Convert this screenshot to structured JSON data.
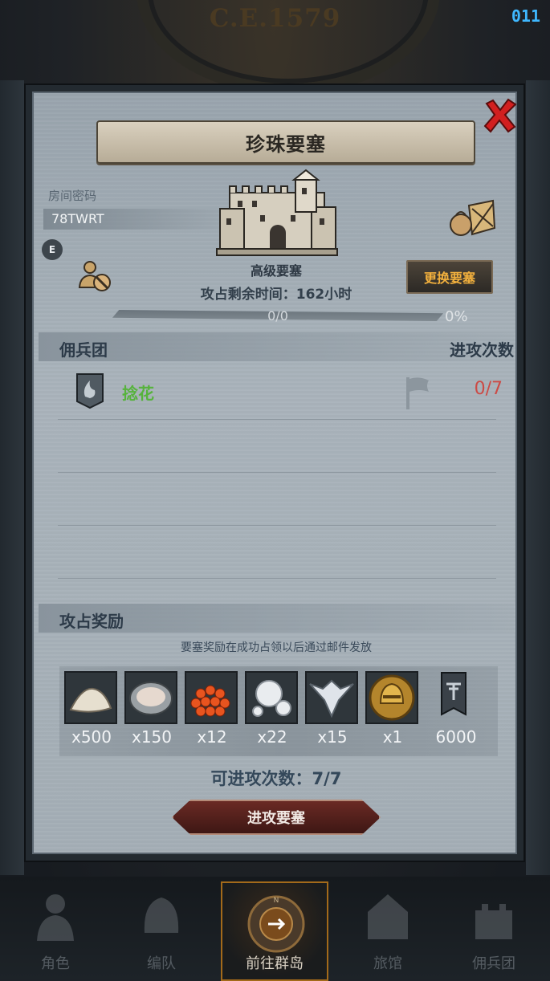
{
  "header": {
    "era": "C.E.1579",
    "signal": "011"
  },
  "modal": {
    "title": "珍珠要塞",
    "room_label": "房间密码",
    "room_code": "78TWRT",
    "badge": "E",
    "fortress_level": "高级要塞",
    "change_button": "更换要塞",
    "timer_text": "攻占剩余时间：162小时",
    "progress": {
      "count": "0/0",
      "percent": "0%",
      "fraction": 0
    },
    "mercenary": {
      "header_left": "佣兵团",
      "header_right": "进攻次数",
      "rows": [
        {
          "name": "捻花",
          "attacks": "0/7"
        }
      ]
    },
    "rewards": {
      "header": "攻占奖励",
      "note": "要塞奖励在成功占领以后通过邮件发放",
      "items": [
        {
          "icon": "salt-pile-icon",
          "qty": "x500"
        },
        {
          "icon": "oyster-icon",
          "qty": "x150"
        },
        {
          "icon": "fish-roe-icon",
          "qty": "x12"
        },
        {
          "icon": "pearls-icon",
          "qty": "x22"
        },
        {
          "icon": "winged-crest-icon",
          "qty": "x15"
        },
        {
          "icon": "golden-helmet-coin-icon",
          "qty": "x1"
        },
        {
          "icon": "guild-banner-icon",
          "qty": "6000"
        }
      ]
    },
    "attempts_text": "可进攻次数：7/7",
    "attack_button": "进攻要塞"
  },
  "bottom_nav": {
    "items": [
      "角色",
      "编队",
      "前往群岛",
      "旅馆",
      "佣兵团"
    ],
    "active": "前往群岛"
  },
  "colors": {
    "accent_orange": "#f2b03d",
    "guild_green": "#56b33c",
    "ratio_red": "#cc4a45",
    "close_red": "#d21f1f"
  }
}
